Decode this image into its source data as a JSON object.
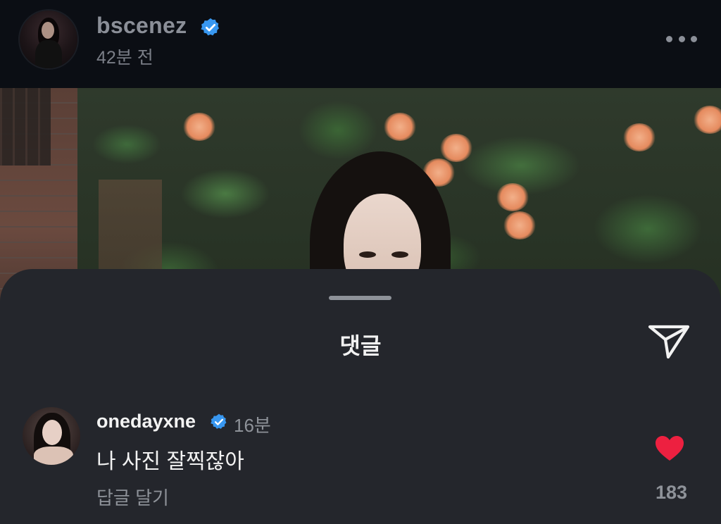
{
  "header": {
    "username": "bscenez",
    "timestamp": "42분 전",
    "avatar_icon": "profile-avatar",
    "verified_icon": "verified-badge-icon",
    "more_icon": "more-options-icon"
  },
  "sheet": {
    "title": "댓글",
    "share_icon": "send-icon"
  },
  "comment": {
    "username": "onedayxne",
    "time": "16분",
    "text": "나 사진 잘찍잖아",
    "reply_label": "답글 달기",
    "like_count": "183",
    "like_icon": "heart-icon",
    "like_color": "#ed2040"
  },
  "colors": {
    "verified_blue": "#3897f0",
    "sheet_bg": "#24262c",
    "header_bg": "#0b0e14"
  }
}
